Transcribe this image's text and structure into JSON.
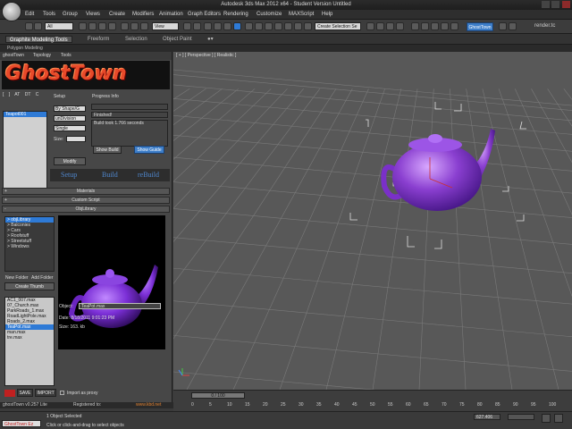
{
  "window": {
    "title": "Autodesk 3ds Max 2012 x64 - Student Version  Untitled"
  },
  "menu": [
    "Edit",
    "Tools",
    "Group",
    "Views",
    "Create",
    "Modifiers",
    "Animation",
    "Graph Editors",
    "Rendering",
    "Customize",
    "MAXScript",
    "Help"
  ],
  "toolbar": {
    "selection_filter": "All",
    "ref_coord": "View",
    "named_selection": "Create Selection Se",
    "ghosttown_button": "GhostTown",
    "render_label": "render.tc"
  },
  "ribbon": {
    "tabs": [
      "Graphite Modeling Tools",
      "Freeform",
      "Selection",
      "Object Paint"
    ],
    "subtab": "Polygon Modeling"
  },
  "ghosttown": {
    "menu": [
      "ghostTown",
      "Topology",
      "Tools"
    ],
    "banner_text": "GhostTown",
    "mini_icons": [
      "[",
      "]",
      "AT",
      "DT",
      "C"
    ],
    "object_list": [
      "Teapot001"
    ],
    "setup": {
      "title": "Setup",
      "by_shape": "By Shape/G",
      "division": "unDivision",
      "mode": "Single",
      "size_label": "Size:",
      "size_value": "",
      "modify_button": "Modify"
    },
    "progress": {
      "title": "Progress Info",
      "status": "Finished!",
      "message": "Build took 1.766 seconds",
      "show_build": "Show Build",
      "show_guide": "Show Guide"
    },
    "big_tabs": [
      "Setup",
      "Build",
      "reBuild"
    ],
    "rollouts": [
      "Materials",
      "Custom Script",
      "ObjLibrary"
    ],
    "library_tree": [
      "> objLibrary",
      "> Balconies",
      "> Cars",
      "> Roofstuff",
      "> Streetstuff",
      "> Windows"
    ],
    "new_folder": "New Folder",
    "add_folder": "Add Folder",
    "create_thumb": "Create Thumb",
    "files": [
      "AC1_007.max",
      "07_Church.max",
      "ParkRoads_1.max",
      "RoadLightPole.max",
      "Roads_2.max",
      "TeaPot.max",
      "man.max",
      "tre.max"
    ],
    "selected_file_index": 5,
    "object_label": "Object:",
    "object_value": "TeaPot.max",
    "date": "Date: 8/18/2011 9:01:23 PM",
    "size": "Size: 163. kb",
    "save": "SAVE",
    "import": "IMPORT",
    "import_proxy": "Import as proxy",
    "version": "ghostTown v0.257 Lite",
    "registered": "Registered to:",
    "url": "www.kbd.net"
  },
  "viewport": {
    "label": "[ + ] [ Perspective ] [ Realistic ]",
    "teapot_color": "#8a3fd0"
  },
  "timeline": {
    "slider": "0 / 100",
    "ticks": [
      "0",
      "5",
      "10",
      "15",
      "20",
      "25",
      "30",
      "35",
      "40",
      "45",
      "50",
      "55",
      "60",
      "65",
      "70",
      "75",
      "80",
      "85",
      "90",
      "95",
      "100"
    ]
  },
  "status": {
    "maxscript_label": "GhostTown Ez",
    "selected": "1 Object Selected",
    "prompt": "Click or click-and-drag to select objects",
    "x_value": "627.406",
    "y_value": ""
  }
}
